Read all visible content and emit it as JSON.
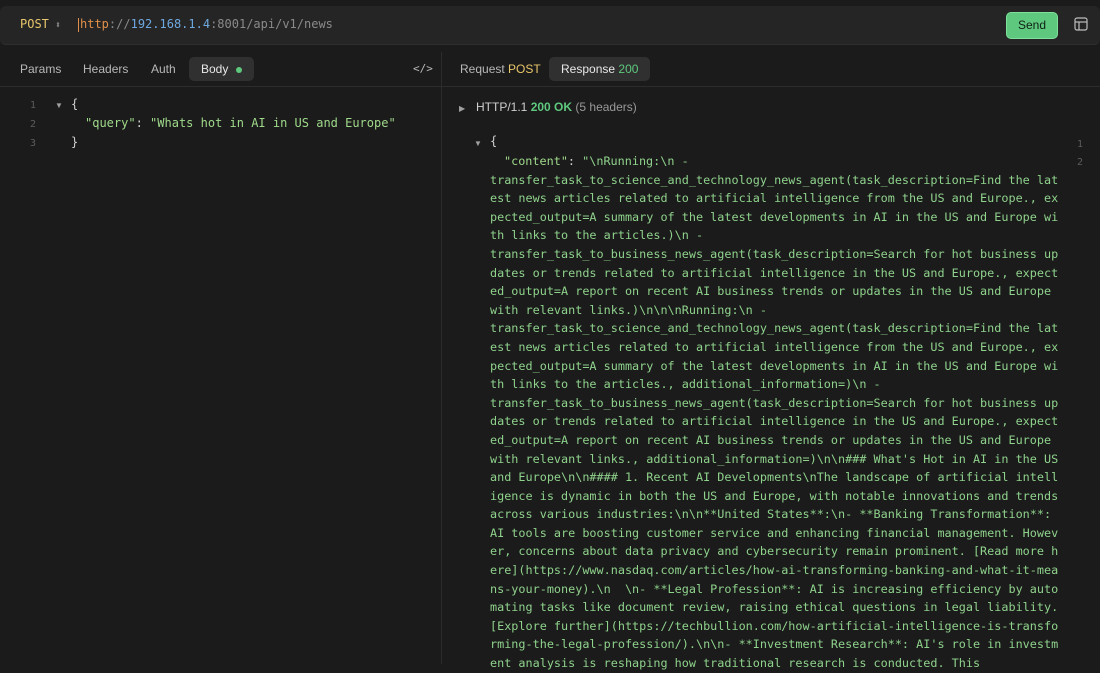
{
  "request": {
    "method": "POST",
    "url_scheme": "http",
    "url_sep": "://",
    "url_host": "192.168.1.4",
    "url_rest": ":8001/api/v1/news",
    "send_label": "Send"
  },
  "left_tabs": [
    "Params",
    "Headers",
    "Auth",
    "Body"
  ],
  "right_tabs": {
    "request_label": "Request",
    "request_method": "POST",
    "response_label": "Response",
    "response_code": "200"
  },
  "body_editor": {
    "line_numbers": [
      "1",
      "2",
      "3"
    ],
    "open_brace": "{",
    "key": "\"query\"",
    "colon": ":",
    "value": "\"Whats hot in AI in US and Europe\"",
    "close_brace": "}"
  },
  "response": {
    "status_protocol": "HTTP/1.1",
    "status_code": "200 OK",
    "headers_count": "(5 headers)",
    "line_numbers": [
      "1",
      "2"
    ],
    "open_brace": "{",
    "content_key": "\"content\"",
    "content_colon": ":",
    "content_text": "\"\\nRunning:\\n -\ntransfer_task_to_science_and_technology_news_agent(task_description=Find the latest news articles related to artificial intelligence from the US and Europe., expected_output=A summary of the latest developments in AI in the US and Europe with links to the articles.)\\n -\ntransfer_task_to_business_news_agent(task_description=Search for hot business updates or trends related to artificial intelligence in the US and Europe., expected_output=A report on recent AI business trends or updates in the US and Europe with relevant links.)\\n\\n\\nRunning:\\n -\ntransfer_task_to_science_and_technology_news_agent(task_description=Find the latest news articles related to artificial intelligence from the US and Europe., expected_output=A summary of the latest developments in AI in the US and Europe with links to the articles., additional_information=)\\n -\ntransfer_task_to_business_news_agent(task_description=Search for hot business updates or trends related to artificial intelligence in the US and Europe., expected_output=A report on recent AI business trends or updates in the US and Europe with relevant links., additional_information=)\\n\\n### What's Hot in AI in the US and Europe\\n\\n#### 1. Recent AI Developments\\nThe landscape of artificial intelligence is dynamic in both the US and Europe, with notable innovations and trends across various industries:\\n\\n**United States**:\\n- **Banking Transformation**: AI tools are boosting customer service and enhancing financial management. However, concerns about data privacy and cybersecurity remain prominent. [Read more here](https://www.nasdaq.com/articles/how-ai-transforming-banking-and-what-it-means-your-money).\\n  \\n- **Legal Profession**: AI is increasing efficiency by automating tasks like document review, raising ethical questions in legal liability. [Explore further](https://techbullion.com/how-artificial-intelligence-is-transforming-the-legal-profession/).\\n\\n- **Investment Research**: AI's role in investment analysis is reshaping how traditional research is conducted. This"
  }
}
